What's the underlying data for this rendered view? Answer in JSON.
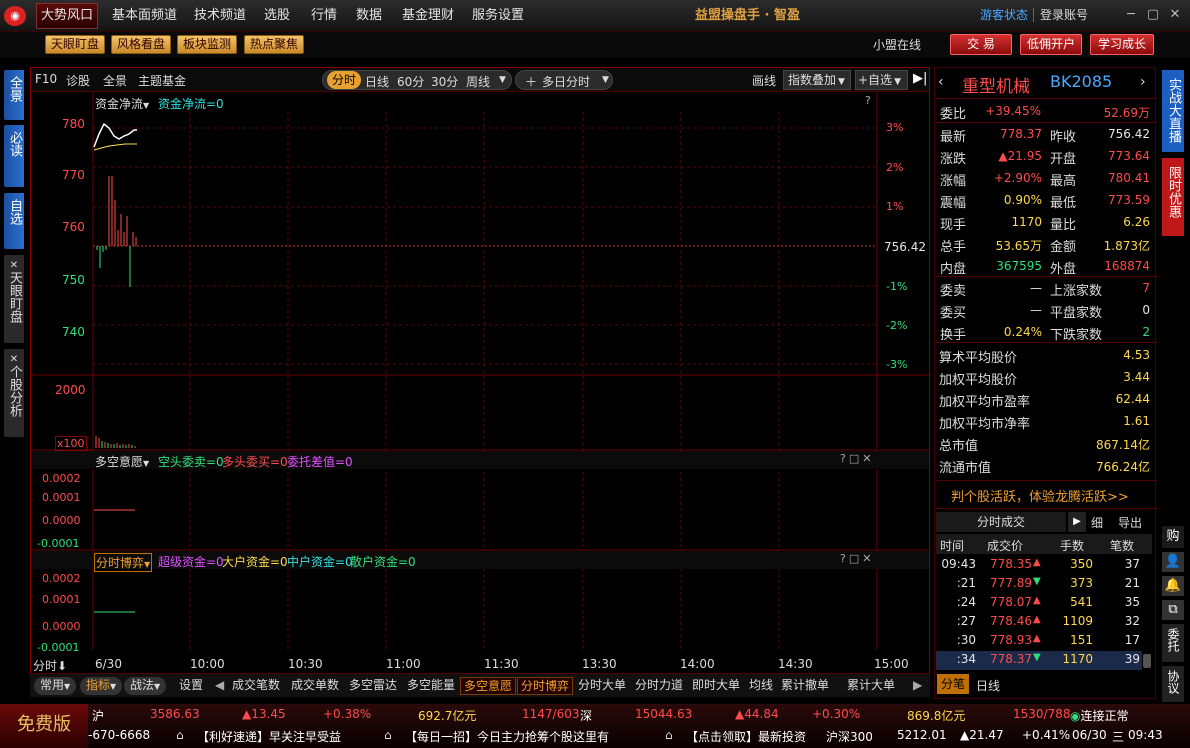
{
  "topbar": {
    "active_menu": "大势风口",
    "menu": [
      "基本面频道",
      "技术频道",
      "选股",
      "行情",
      "数据",
      "基金理财",
      "服务设置"
    ],
    "app_title": "益盟操盘手 · 智盈",
    "guest_status": "游客状态",
    "login": "登录账号"
  },
  "toolbar": {
    "tools": [
      "天眼盯盘",
      "风格看盘",
      "板块监测",
      "热点聚焦"
    ],
    "online": "小盟在线",
    "trade": "交 易",
    "open_account": "低佣开户",
    "learn": "学习成长"
  },
  "left_tabs": [
    "全景",
    "必读",
    "自选",
    "天眼盯盘",
    "个股分析"
  ],
  "chart_head": {
    "f10": "F10",
    "diagnose": "诊股",
    "panorama": "全景",
    "theme_fund": "主题基金",
    "periods": [
      "分时",
      "日线",
      "60分",
      "30分",
      "周线"
    ],
    "multi_day": "多日分时",
    "draw": "画线",
    "index_overlay": "指数叠加",
    "add_fav": "+自选"
  },
  "main_chart": {
    "indicator": "资金净流",
    "indicator_value": "资金净流=0",
    "y_labels": [
      "780",
      "770",
      "760",
      "750",
      "740"
    ],
    "pct_labels": [
      "3%",
      "2%",
      "1%",
      "-1%",
      "-2%",
      "-3%"
    ],
    "prev_close": "756.42",
    "vol_label": "2000",
    "vol_mult": "x100",
    "question": "?"
  },
  "panel2": {
    "name": "多空意愿",
    "short": "空头委卖=0",
    "long": "多头委买=0",
    "diff": "委托差值=0",
    "y_labels": [
      "0.0002",
      "0.0001",
      "0.0000",
      "-0.0001"
    ]
  },
  "panel3": {
    "name": "分时博弈",
    "super": "超级资金=0",
    "big": "大户资金=0",
    "mid": "中户资金=0",
    "retail": "散户资金=0",
    "y_labels": [
      "0.0002",
      "0.0001",
      "0.0000",
      "-0.0001"
    ]
  },
  "time_axis": {
    "label": "分时",
    "date": "6/30",
    "times": [
      "10:00",
      "10:30",
      "11:00",
      "11:30",
      "13:30",
      "14:00",
      "14:30",
      "15:00"
    ]
  },
  "bottom_tabs": {
    "left": [
      "常用",
      "指标",
      "战法",
      "设置"
    ],
    "tabs": [
      "成交笔数",
      "成交单数",
      "多空雷达",
      "多空能量",
      "多空意愿",
      "分时博弈",
      "分时大单",
      "分时力道",
      "即时大单",
      "均线",
      "累计撤单",
      "累计大单"
    ],
    "selected": [
      "多空意愿",
      "分时博弈"
    ]
  },
  "stock": {
    "name": "重型机械",
    "code": "BK2085",
    "weibi_label": "委比",
    "weibi": "+39.45%",
    "weicha": "52.69万",
    "rows": [
      {
        "l1": "最新",
        "v1": "778.37",
        "c1": "red",
        "l2": "昨收",
        "v2": "756.42",
        "c2": "wht"
      },
      {
        "l1": "涨跌",
        "v1": "▲21.95",
        "c1": "red",
        "l2": "开盘",
        "v2": "773.64",
        "c2": "red"
      },
      {
        "l1": "涨幅",
        "v1": "+2.90%",
        "c1": "red",
        "l2": "最高",
        "v2": "780.41",
        "c2": "red"
      },
      {
        "l1": "震幅",
        "v1": "0.90%",
        "c1": "yel",
        "l2": "最低",
        "v2": "773.59",
        "c2": "red"
      },
      {
        "l1": "现手",
        "v1": "1170",
        "c1": "yel",
        "l2": "量比",
        "v2": "6.26",
        "c2": "yel"
      },
      {
        "l1": "总手",
        "v1": "53.65万",
        "c1": "yel",
        "l2": "金额",
        "v2": "1.873亿",
        "c2": "yel"
      },
      {
        "l1": "内盘",
        "v1": "367595",
        "c1": "grn",
        "l2": "外盘",
        "v2": "168874",
        "c2": "red"
      }
    ],
    "rows2": [
      {
        "l1": "委卖",
        "v1": "—",
        "c1": "wht",
        "l2": "上涨家数",
        "v2": "7",
        "c2": "red"
      },
      {
        "l1": "委买",
        "v1": "—",
        "c1": "wht",
        "l2": "平盘家数",
        "v2": "0",
        "c2": "wht"
      },
      {
        "l1": "换手",
        "v1": "0.24%",
        "c1": "yel",
        "l2": "下跌家数",
        "v2": "2",
        "c2": "grn"
      }
    ],
    "stats": [
      {
        "l": "算术平均股价",
        "v": "4.53"
      },
      {
        "l": "加权平均股价",
        "v": "3.44"
      },
      {
        "l": "加权平均市盈率",
        "v": "62.44"
      },
      {
        "l": "加权平均市净率",
        "v": "1.61"
      },
      {
        "l": "总市值",
        "v": "867.14亿"
      },
      {
        "l": "流通市值",
        "v": "766.24亿"
      }
    ],
    "promo": "判个股活跃，体验龙腾活跃>>"
  },
  "trades": {
    "title": "分时成交",
    "detail": "细",
    "export": "导出",
    "headers": [
      "时间",
      "成交价",
      "手数",
      "笔数"
    ],
    "rows": [
      {
        "t": "09:43",
        "p": "778.35",
        "d": "▲",
        "dc": "red",
        "v": "350",
        "n": "37"
      },
      {
        "t": ":21",
        "p": "777.89",
        "d": "▼",
        "dc": "grn",
        "v": "373",
        "n": "21"
      },
      {
        "t": ":24",
        "p": "778.07",
        "d": "▲",
        "dc": "red",
        "v": "541",
        "n": "35"
      },
      {
        "t": ":27",
        "p": "778.46",
        "d": "▲",
        "dc": "red",
        "v": "1109",
        "n": "32"
      },
      {
        "t": ":30",
        "p": "778.93",
        "d": "▲",
        "dc": "red",
        "v": "151",
        "n": "17"
      },
      {
        "t": ":34",
        "p": "778.37",
        "d": "▼",
        "dc": "grn",
        "v": "1170",
        "n": "39"
      }
    ],
    "tab_trade": "分笔",
    "tab_day": "日线"
  },
  "right_tabs": [
    "实战大直播",
    "限时优惠"
  ],
  "right_small": [
    "购",
    "委托",
    "协议"
  ],
  "status": {
    "free": "免费版",
    "sh_label": "沪",
    "sh_price": "3586.63",
    "sh_chg": "▲13.45",
    "sh_pct": "+0.38%",
    "sh_amt": "692.7亿元",
    "sh_ud": "1147/603",
    "sz_label": "深",
    "sz_price": "15044.63",
    "sz_chg": "▲44.84",
    "sz_pct": "+0.30%",
    "sz_amt": "869.8亿元",
    "sz_ud": "1530/788",
    "conn": "连接正常",
    "phone": "-670-6668",
    "news1": "【利好速递】早关注早受益",
    "news2": "【每日一招】今日主力抢筹个股这里有",
    "news3": "【点击领取】最新投资",
    "hs_label": "沪深300",
    "hs_price": "5212.01",
    "hs_chg": "▲21.47",
    "hs_pct": "+0.41%",
    "date": "06/30",
    "weekday": "三",
    "time": "09:43"
  },
  "colors": {
    "accent": "#e7a130",
    "up": "#ff4b4b",
    "down": "#2fe07a",
    "grid": "#8a0000"
  }
}
